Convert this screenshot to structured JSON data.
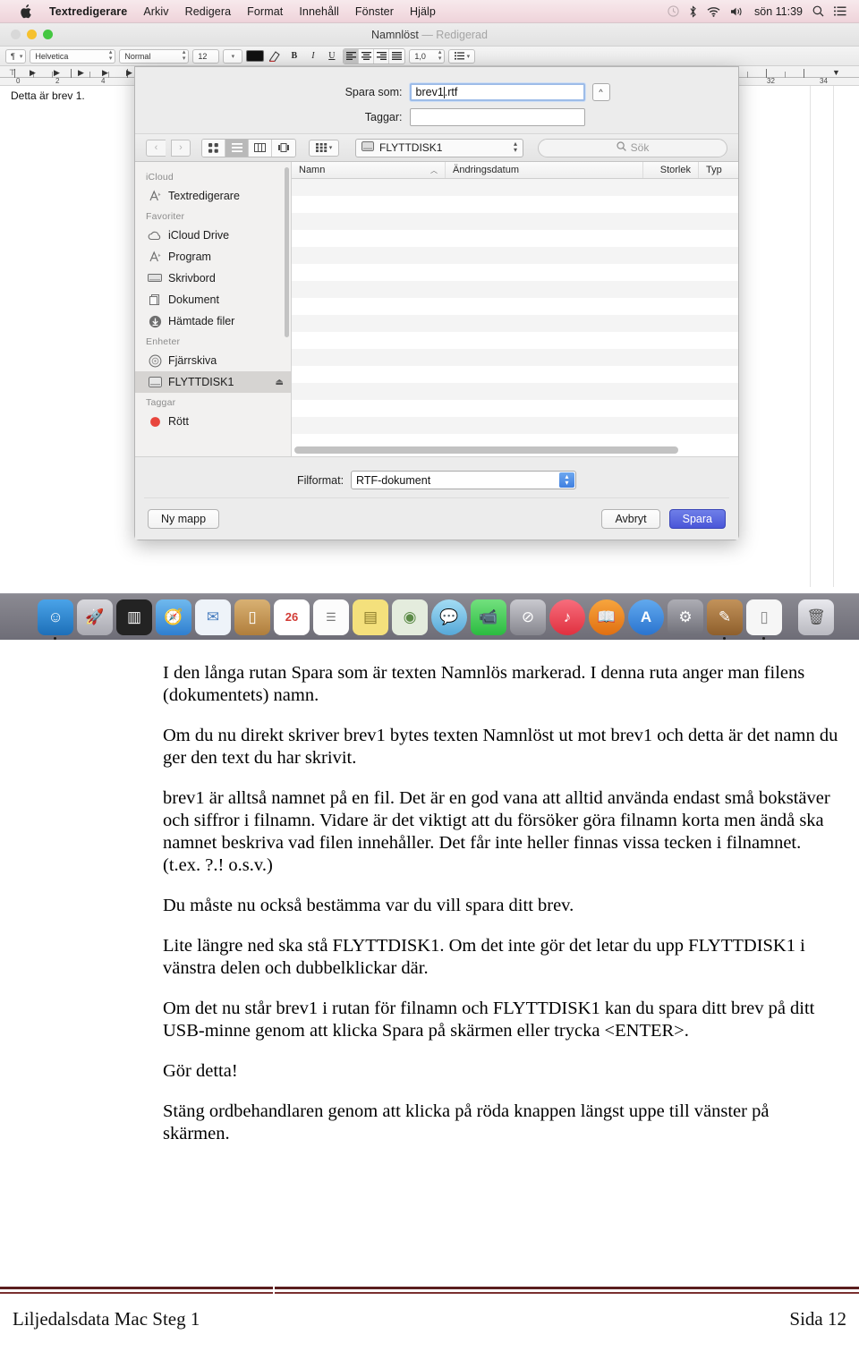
{
  "menubar": {
    "apple_icon": "apple-logo",
    "items": [
      {
        "label": "Textredigerare",
        "bold": true
      },
      {
        "label": "Arkiv",
        "bold": false
      },
      {
        "label": "Redigera",
        "bold": false
      },
      {
        "label": "Format",
        "bold": false
      },
      {
        "label": "Innehåll",
        "bold": false
      },
      {
        "label": "Fönster",
        "bold": false
      },
      {
        "label": "Hjälp",
        "bold": false
      }
    ],
    "status": {
      "timemachine_icon": "clock-icon",
      "bluetooth_icon": "bluetooth-icon",
      "wifi_icon": "wifi-icon",
      "volume_icon": "speaker-icon",
      "clock": "sön 11:39",
      "search_icon": "search-icon",
      "notifications_icon": "list-icon"
    }
  },
  "window": {
    "title": "Namnlöst",
    "title_dim": "— Redigerad",
    "traffic": {
      "close": "close-button",
      "minimize": "minimize-button",
      "zoom": "zoom-button"
    }
  },
  "format_toolbar": {
    "style_menu": "¶",
    "font_family": "Helvetica",
    "font_style": "Normal",
    "font_size": "12",
    "color_swatch": "#111111",
    "highlight_icon": "highlighter-icon",
    "bold": "B",
    "italic": "I",
    "underline": "U",
    "align_left": "align-left-icon",
    "align_center": "align-center-icon",
    "align_right": "align-right-icon",
    "align_justify": "align-justify-icon",
    "line_spacing": "1,0",
    "list_icon": "list-icon"
  },
  "ruler": {
    "numbers": [
      "0",
      "2",
      "4",
      "32",
      "34"
    ]
  },
  "document": {
    "text": "Detta är brev 1."
  },
  "save_sheet": {
    "save_as_label": "Spara som:",
    "save_as_value_pre": "brev1",
    "save_as_value_post": ".rtf",
    "save_as_full": "brev1.rtf",
    "tags_label": "Taggar:",
    "tags_value": "",
    "expand_icon": "chevron-up-icon",
    "toolbar": {
      "back_icon": "chevron-left-icon",
      "forward_icon": "chevron-right-icon",
      "view_icon": "icon-view-icon",
      "view_list": "list-view-icon",
      "view_column": "column-view-icon",
      "view_cover": "coverflow-view-icon",
      "action_icon": "grid-action-icon",
      "location_icon": "harddisk-icon",
      "location": "FLYTTDISK1",
      "search_icon": "search-icon",
      "search_placeholder": "Sök"
    },
    "sidebar": [
      {
        "type": "header",
        "label": "iCloud"
      },
      {
        "type": "item",
        "label": "Textredigerare",
        "icon": "textedit-icon",
        "selected": false
      },
      {
        "type": "header",
        "label": "Favoriter"
      },
      {
        "type": "item",
        "label": "iCloud Drive",
        "icon": "cloud-icon",
        "selected": false
      },
      {
        "type": "item",
        "label": "Program",
        "icon": "applications-icon",
        "selected": false
      },
      {
        "type": "item",
        "label": "Skrivbord",
        "icon": "desktop-icon",
        "selected": false
      },
      {
        "type": "item",
        "label": "Dokument",
        "icon": "documents-icon",
        "selected": false
      },
      {
        "type": "item",
        "label": "Hämtade filer",
        "icon": "downloads-icon",
        "selected": false
      },
      {
        "type": "header",
        "label": "Enheter"
      },
      {
        "type": "item",
        "label": "Fjärrskiva",
        "icon": "remotedisc-icon",
        "selected": false
      },
      {
        "type": "item",
        "label": "FLYTTDISK1",
        "icon": "harddisk-icon",
        "selected": true,
        "eject": "eject-icon"
      },
      {
        "type": "header",
        "label": "Taggar"
      },
      {
        "type": "item",
        "label": "Rött",
        "icon": "red-tag-icon",
        "selected": false
      }
    ],
    "columns": [
      {
        "key": "name",
        "label": "Namn",
        "sort": "▲"
      },
      {
        "key": "date",
        "label": "Ändringsdatum"
      },
      {
        "key": "size",
        "label": "Storlek"
      },
      {
        "key": "type",
        "label": "Typ"
      }
    ],
    "rows": [],
    "file_format_label": "Filformat:",
    "file_format_value": "RTF-dokument",
    "new_folder_button": "Ny mapp",
    "cancel_button": "Avbryt",
    "save_button": "Spara",
    "accent_color": "#4a56d8"
  },
  "dock": {
    "icons": [
      {
        "name": "finder-icon",
        "glyph": "☺",
        "bg": "#3d9ae0",
        "running": true
      },
      {
        "name": "launchpad-icon",
        "glyph": "🚀",
        "bg": "#bcbcc2",
        "running": false
      },
      {
        "name": "mission-control-icon",
        "glyph": "▤",
        "bg": "#2b2b2b",
        "running": false
      },
      {
        "name": "safari-icon",
        "glyph": "🧭",
        "bg": "#3f8fe0",
        "running": false
      },
      {
        "name": "mail-icon",
        "glyph": "✉",
        "bg": "#e8eef6",
        "running": false
      },
      {
        "name": "contacts-icon",
        "glyph": "▯",
        "bg": "#c79a5b",
        "running": false
      },
      {
        "name": "calendar-icon",
        "glyph": "26",
        "bg": "#ffffff",
        "running": false
      },
      {
        "name": "reminders-icon",
        "glyph": "☰",
        "bg": "#fdfdfd",
        "running": false
      },
      {
        "name": "notes-icon",
        "glyph": "▤",
        "bg": "#f6e27a",
        "running": false
      },
      {
        "name": "maps-icon",
        "glyph": "◉",
        "bg": "#dfe8d8",
        "running": false
      },
      {
        "name": "messages-icon",
        "glyph": "💬",
        "bg": "#7cc7ee",
        "running": false
      },
      {
        "name": "facetime-icon",
        "glyph": "📹",
        "bg": "#4cd35c",
        "running": false
      },
      {
        "name": "photobooth-icon",
        "glyph": "⊘",
        "bg": "#8f8f97",
        "running": false
      },
      {
        "name": "itunes-icon",
        "glyph": "♪",
        "bg": "#ef4a5c",
        "running": false
      },
      {
        "name": "ibooks-icon",
        "glyph": "📖",
        "bg": "#f08a25",
        "running": false
      },
      {
        "name": "appstore-icon",
        "glyph": "A",
        "bg": "#3b8fe6",
        "running": false
      },
      {
        "name": "systempreferences-icon",
        "glyph": "⚙",
        "bg": "#8a8a90",
        "running": false
      },
      {
        "name": "textedit-icon",
        "glyph": "✎",
        "bg": "#b5773c",
        "running": true
      },
      {
        "name": "document-icon",
        "glyph": "▯",
        "bg": "#f3f3f3",
        "running": true
      }
    ],
    "trash": {
      "name": "trash-icon",
      "glyph": "🗑"
    }
  },
  "article": {
    "paragraphs": [
      "I den långa rutan Spara som är texten Namnlös markerad. I denna ruta anger man filens (dokumentets) namn.",
      "Om du nu direkt skriver brev1 bytes texten Namnlöst ut mot brev1 och detta är det namn du ger den text du har skrivit.",
      "brev1 är alltså namnet på en fil. Det är en god vana att alltid använda endast små bokstäver och siffror i filnamn. Vidare är det viktigt att du försöker göra filnamn korta men ändå ska namnet beskriva vad filen innehåller. Det får inte heller finnas vissa tecken i filnamnet. (t.ex. ?.! o.s.v.)",
      "Du måste nu också bestämma var du vill spara ditt brev.",
      "Lite längre ned ska stå FLYTTDISK1. Om det inte gör det letar du upp FLYTTDISK1 i vänstra delen och dubbelklickar där.",
      "Om det nu står brev1 i rutan för filnamn och FLYTTDISK1  kan du spara ditt brev på ditt USB-minne genom att klicka Spara på skärmen eller trycka <ENTER>.",
      "Gör detta!",
      "Stäng ordbehandlaren genom att klicka på röda knappen längst uppe till vänster på skärmen."
    ]
  },
  "footer": {
    "left": "Liljedalsdata Mac Steg 1",
    "right": "Sida 12",
    "rule_color": "#5b1f1f"
  }
}
